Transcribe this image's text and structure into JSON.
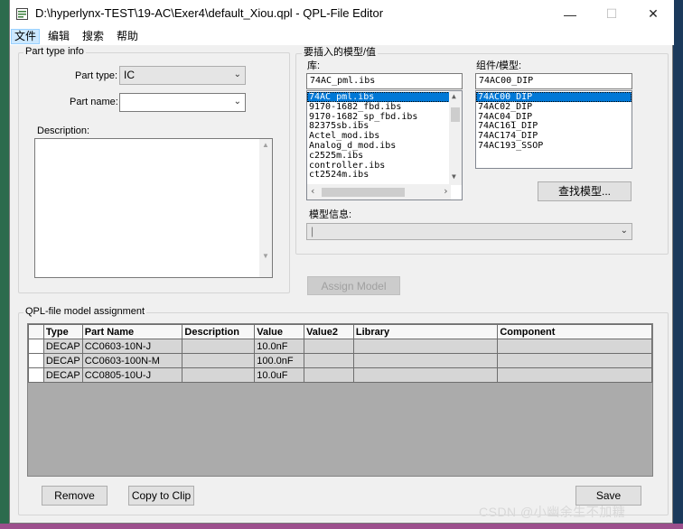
{
  "window": {
    "title": "D:\\hyperlynx-TEST\\19-AC\\Exer4\\default_Xiou.qpl - QPL-File Editor",
    "minimize": "—",
    "maximize": "☐",
    "close": "✕"
  },
  "menu": [
    "文件",
    "编辑",
    "搜索",
    "帮助"
  ],
  "part_info": {
    "legend": "Part type info",
    "type_label": "Part type:",
    "type_value": "IC",
    "name_label": "Part name:",
    "name_value": "",
    "desc_label": "Description:",
    "desc_value": ""
  },
  "model_insert": {
    "legend": "要插入的模型/值",
    "lib_label": "库:",
    "lib_value": "74AC_pml.ibs",
    "libraries": [
      "74AC_pml.ibs",
      "9170-1682_fbd.ibs",
      "9170-1682_sp_fbd.ibs",
      "82375sb.ibs",
      "Actel_mod.ibs",
      "Analog_d_mod.ibs",
      "c2525m.ibs",
      "controller.ibs",
      "ct2524m.ibs"
    ],
    "comp_label": "组件/模型:",
    "comp_value": "74AC00_DIP",
    "components": [
      "74AC00_DIP",
      "74AC02_DIP",
      "74AC04_DIP",
      "74AC161_DIP",
      "74AC174_DIP",
      "74AC193_SSOP"
    ],
    "find_button": "查找模型...",
    "info_label": "模型信息:",
    "info_value": "|"
  },
  "assign_button": "Assign Model",
  "assignment": {
    "legend": "QPL-file model assignment",
    "columns": [
      "Type",
      "Part Name",
      "Description",
      "Value",
      "Value2",
      "Library",
      "Component"
    ],
    "rows": [
      [
        "DECAP",
        "CC0603-10N-J",
        "",
        "10.0nF",
        "",
        "",
        ""
      ],
      [
        "DECAP",
        "CC0603-100N-M",
        "",
        "100.0nF",
        "",
        "",
        ""
      ],
      [
        "DECAP",
        "CC0805-10U-J",
        "",
        "10.0uF",
        "",
        "",
        ""
      ]
    ]
  },
  "buttons": {
    "remove": "Remove",
    "copy": "Copy to Clip",
    "save": "Save"
  },
  "watermark": "CSDN @小幽余生不加糖"
}
